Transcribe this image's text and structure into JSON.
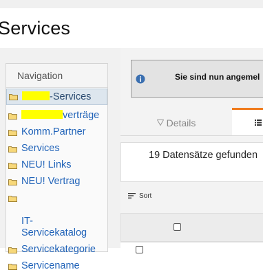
{
  "page": {
    "title": "Services"
  },
  "navigation": {
    "header": "Navigation",
    "items": [
      {
        "label": "-Services",
        "redacted_prefix": true,
        "selected": true
      },
      {
        "label": "verträge",
        "redacted_prefix": true
      },
      {
        "label": "Komm.Partner"
      },
      {
        "label": "Services"
      },
      {
        "label": "NEU! Links"
      },
      {
        "label": "NEU! Vertrag"
      },
      {
        "label": "IT-\nServicekatalog"
      },
      {
        "label": "Servicekategorie"
      },
      {
        "label": "Servicename"
      }
    ]
  },
  "notification": {
    "text": "Sie sind nun angemel",
    "icon": "info-icon"
  },
  "tabs": [
    {
      "label": "Details",
      "icon": "filter-icon",
      "active": false
    },
    {
      "label": "",
      "icon": "list-icon",
      "active": true
    }
  ],
  "results": {
    "text": "19 Datensätze gefunden"
  },
  "toolbar": {
    "sort_label": "Sort"
  },
  "colors": {
    "accent": "#f07b1c",
    "link": "#1f62b8",
    "redaction": "#ffff00"
  }
}
